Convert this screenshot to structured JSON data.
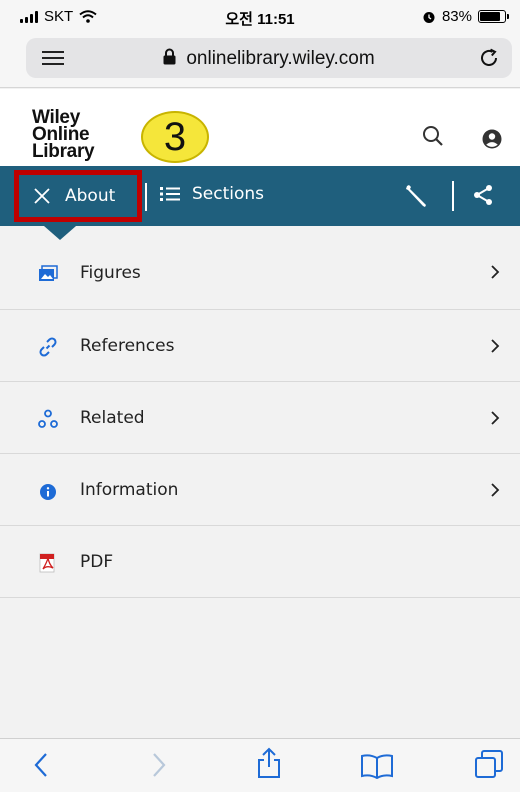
{
  "status_bar": {
    "carrier": "SKT",
    "time": "오전 11:51",
    "battery_percent": "83%",
    "battery_level": 0.83
  },
  "browser": {
    "url": "onlinelibrary.wiley.com"
  },
  "site": {
    "logo_lines": [
      "Wiley",
      "Online",
      "Library"
    ],
    "step_badge": "3"
  },
  "toolbar": {
    "about_label": "About",
    "sections_label": "Sections"
  },
  "menu": {
    "items": [
      {
        "label": "Figures",
        "icon": "image-icon",
        "has_chevron": true
      },
      {
        "label": "References",
        "icon": "link-icon",
        "has_chevron": true
      },
      {
        "label": "Related",
        "icon": "related-icon",
        "has_chevron": true
      },
      {
        "label": "Information",
        "icon": "info-icon",
        "has_chevron": true
      },
      {
        "label": "PDF",
        "icon": "pdf-icon",
        "has_chevron": false
      }
    ]
  },
  "colors": {
    "toolbar_bg": "#1f5f7d",
    "highlight_border": "#c00000",
    "badge_fill": "#f5e63a",
    "link_blue": "#1e6bd6"
  }
}
